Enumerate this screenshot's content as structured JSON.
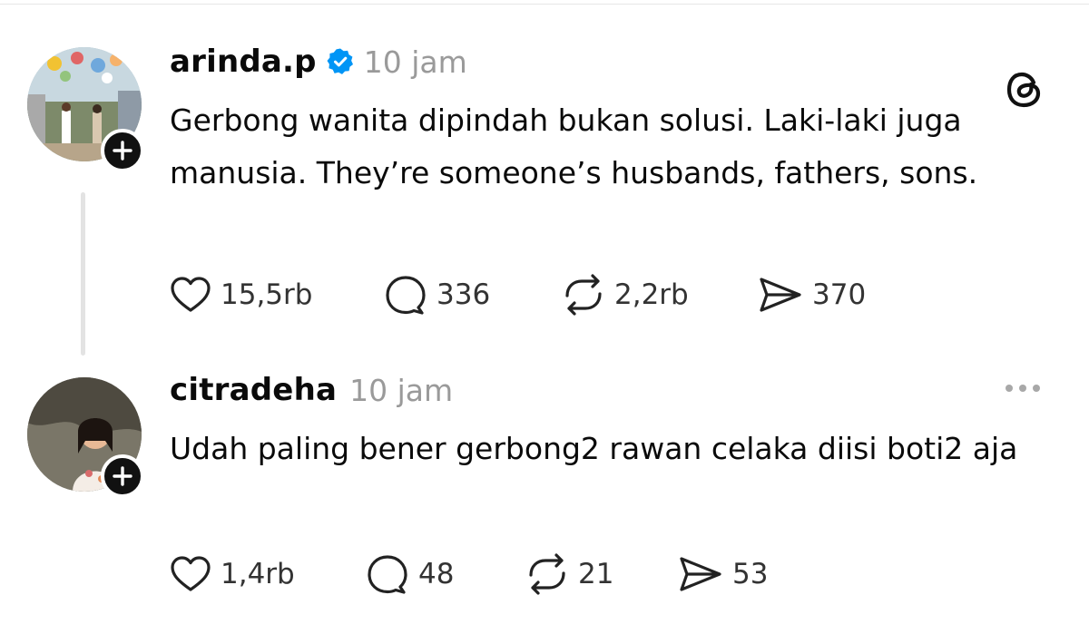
{
  "posts": [
    {
      "username": "arinda.p",
      "verified": true,
      "time": "10 jam",
      "text": "Gerbong wanita dipindah bukan solusi. Laki-laki juga manusia. They’re someone’s husbands, fathers, sons.",
      "likes": "15,5rb",
      "replies": "336",
      "reposts": "2,2rb",
      "shares": "370"
    },
    {
      "username": "citradeha",
      "verified": false,
      "time": "10 jam",
      "text": "Udah paling bener gerbong2 rawan celaka diisi boti2 aja",
      "likes": "1,4rb",
      "replies": "48",
      "reposts": "21",
      "shares": "53"
    }
  ],
  "colors": {
    "verified_badge": "#0095f6",
    "muted_text": "#9a9a9a",
    "thread_line": "#e3e3e3"
  },
  "icons": [
    "threads-logo-icon",
    "heart-icon",
    "comment-icon",
    "repost-icon",
    "share-icon",
    "plus-icon",
    "more-icon",
    "verified-badge-icon"
  ]
}
